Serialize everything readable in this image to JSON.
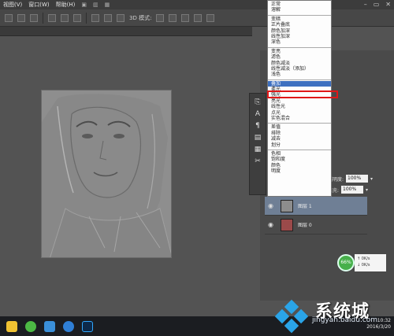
{
  "menubar": {
    "items": [
      "视图(V)",
      "窗口(W)",
      "帮助(H)"
    ],
    "window_controls": [
      "–",
      "▭",
      "✕"
    ]
  },
  "options_bar": {
    "mode_label": "3D 模式:"
  },
  "blend_menu": {
    "groups": [
      [
        "正常",
        "溶解"
      ],
      [
        "变暗",
        "正片叠底",
        "颜色加深",
        "线性加深",
        "深色"
      ],
      [
        "变亮",
        "滤色",
        "颜色减淡",
        "线性减淡（添加）",
        "浅色"
      ],
      [
        "叠加",
        "柔光",
        "强光",
        "亮光",
        "线性光",
        "点光",
        "实色混合"
      ],
      [
        "差值",
        "排除",
        "减去",
        "划分"
      ],
      [
        "色相",
        "饱和度",
        "颜色",
        "明度"
      ]
    ],
    "highlighted": "叠加"
  },
  "layers_panel": {
    "opacity_label": "透明度:",
    "opacity_value": "100%",
    "fill_label": "填充:",
    "fill_value": "100%",
    "layers": [
      {
        "name": "图层 1",
        "selected": true
      },
      {
        "name": "图层 0",
        "selected": false
      }
    ]
  },
  "speed_widget": {
    "percent": "66%",
    "up": "0K/s",
    "down": "0K/s"
  },
  "clock": {
    "time": "10:32",
    "date": "2016/3/20"
  },
  "watermark": {
    "brand": "系统城",
    "url": "jingyan.baidu.com"
  },
  "colors": {
    "accent_highlight": "#3e70c0",
    "annotation_red": "#e01818",
    "layer_selected": "#6f7f95"
  }
}
